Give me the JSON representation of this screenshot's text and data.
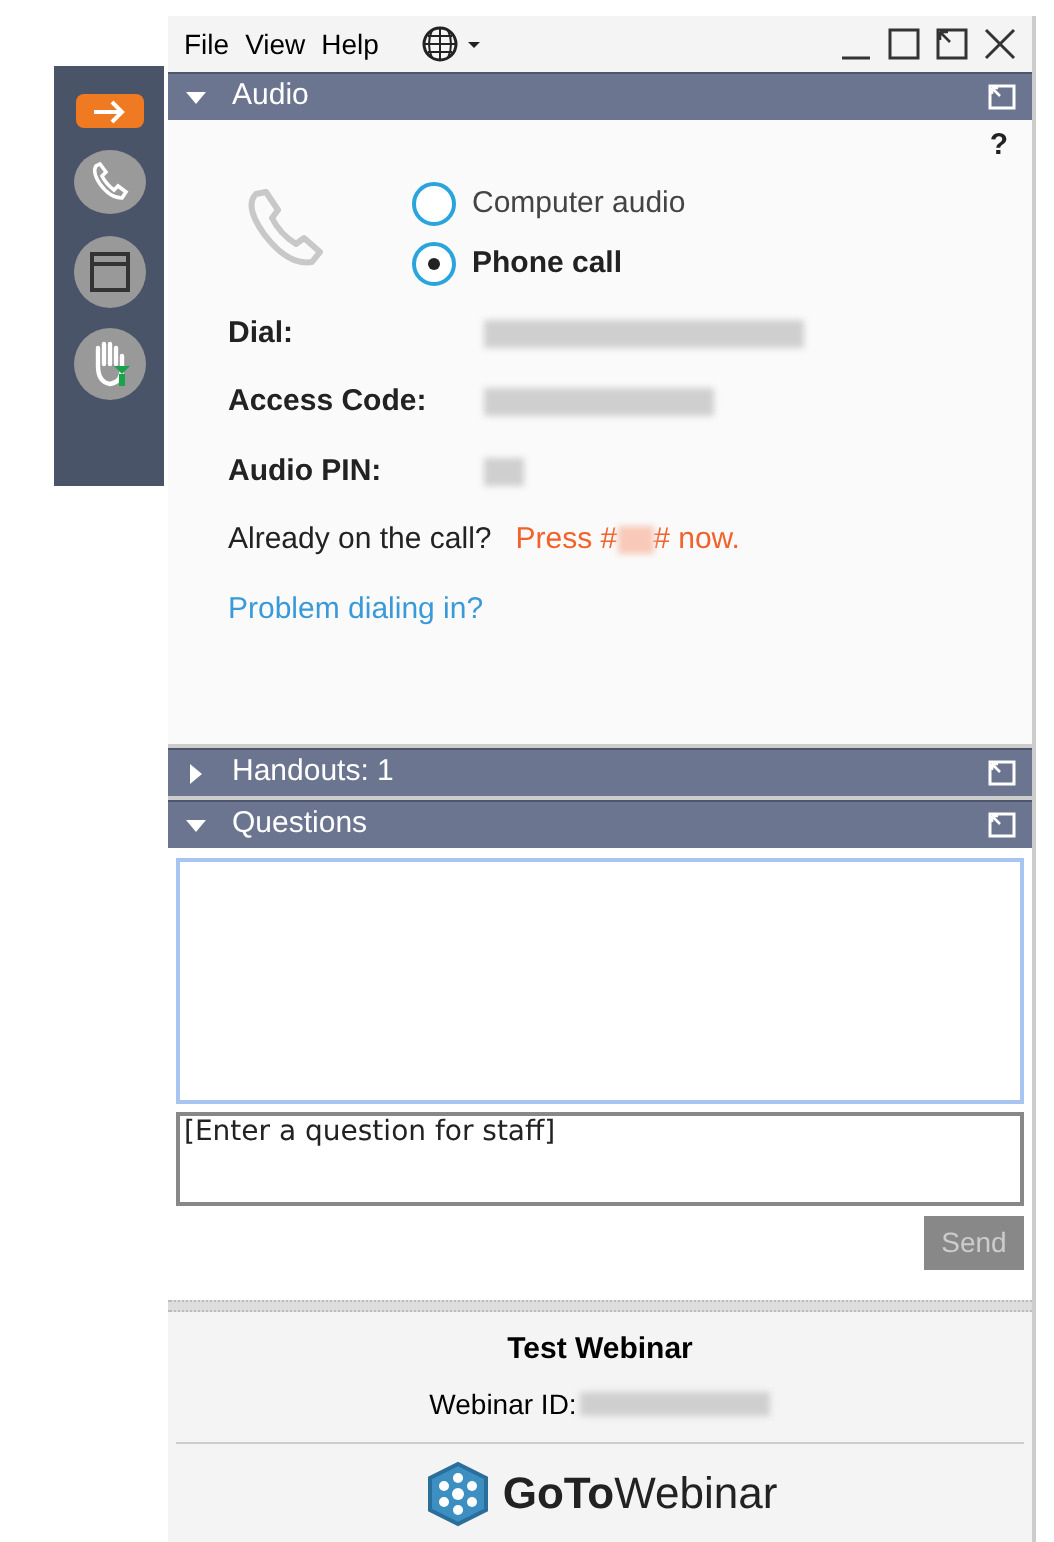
{
  "menu": [
    "File",
    "View",
    "Help"
  ],
  "sidebar": [
    {
      "kind": "arrow",
      "selected": true
    },
    {
      "kind": "phone",
      "selected": false
    },
    {
      "kind": "window",
      "selected": false
    },
    {
      "kind": "hand",
      "selected": false
    }
  ],
  "audio": {
    "title": "Audio",
    "expanded": true,
    "help": "?",
    "options": [
      {
        "label": "Computer audio",
        "selected": false
      },
      {
        "label": "Phone call",
        "selected": true
      }
    ],
    "fields": [
      {
        "label": "Dial:"
      },
      {
        "label": "Access Code:"
      },
      {
        "label": "Audio PIN:"
      }
    ],
    "already": "Already on the call?",
    "press_prefix": "Press #",
    "press_suffix": "# now.",
    "problem_link": "Problem dialing in?"
  },
  "handouts": {
    "title": "Handouts: 1",
    "expanded": false
  },
  "questions": {
    "title": "Questions",
    "expanded": true,
    "placeholder": "[Enter a question for staff]",
    "send": "Send"
  },
  "footer": {
    "title": "Test Webinar",
    "id_label": "Webinar ID:",
    "logo": "**GoTo**Webinar"
  }
}
